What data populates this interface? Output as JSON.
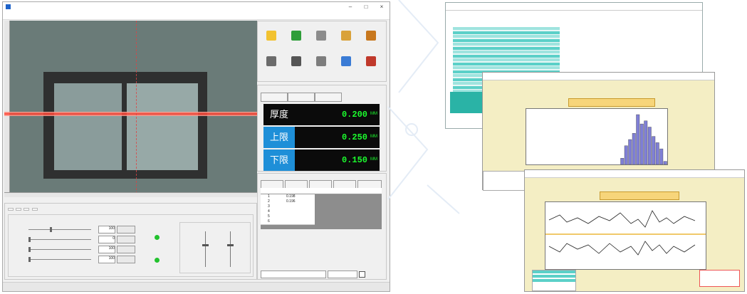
{
  "app": {
    "window_title": "",
    "menu": []
  },
  "camera": {},
  "tool_panel": {
    "title": "",
    "tools": [
      {
        "label": "",
        "icon": "lightbulb-icon",
        "color": "#f2c230"
      },
      {
        "label": "",
        "icon": "green-square-icon",
        "color": "#2f9e3a"
      },
      {
        "label": "",
        "icon": "stamp-icon",
        "color": "#8c8c8c"
      },
      {
        "label": "",
        "icon": "magnet-icon",
        "color": "#d9a23a"
      },
      {
        "label": "",
        "icon": "brush-icon",
        "color": "#c8781e"
      },
      {
        "label": "",
        "icon": "device-icon",
        "color": "#6b6b6b"
      },
      {
        "label": "",
        "icon": "helmet-icon",
        "color": "#555555"
      },
      {
        "label": "",
        "icon": "circle-icon",
        "color": "#7d7d7d"
      },
      {
        "label": "",
        "icon": "edit-icon",
        "color": "#3a7bd5"
      },
      {
        "label": "",
        "icon": "toolbox-icon",
        "color": "#c0392b"
      }
    ]
  },
  "readout": {
    "group_title": "",
    "tabs": [
      "",
      "",
      ""
    ],
    "rows": [
      {
        "label": "厚度",
        "value": "0.200",
        "unit": "MM",
        "label_bg": "#0b0b0b"
      },
      {
        "label": "上限",
        "value": "0.250",
        "unit": "MM",
        "label_bg": "#1e8fd8"
      },
      {
        "label": "下限",
        "value": "0.150",
        "unit": "MM",
        "label_bg": "#1e8fd8"
      }
    ]
  },
  "records": {
    "group_title": "",
    "buttons": [
      "",
      "",
      "",
      "",
      ""
    ],
    "headers": [
      "",
      "",
      "",
      "",
      ""
    ],
    "rows": [
      {
        "no": "1",
        "value": "0.198"
      },
      {
        "no": "2",
        "value": "0.196"
      },
      {
        "no": "3",
        "value": ""
      },
      {
        "no": "4",
        "value": ""
      },
      {
        "no": "5",
        "value": ""
      },
      {
        "no": "6",
        "value": ""
      }
    ]
  },
  "controls": {
    "tabs": [
      "",
      "",
      "",
      ""
    ],
    "sliders": [
      {
        "name": "",
        "value": "100",
        "level": 0.35
      },
      {
        "name": "",
        "value": "0",
        "level": 0.0
      },
      {
        "name": "",
        "value": "100",
        "level": 0.0
      },
      {
        "name": "",
        "value": "100",
        "level": 0.0
      }
    ]
  },
  "status_bar": {
    "left": "",
    "datetime": "",
    "right": ""
  },
  "reports": {
    "chart1_title": "",
    "chart2_title": "",
    "histogram_bins": [
      0,
      0,
      0,
      0,
      0,
      0,
      0,
      0,
      0,
      0,
      0,
      0,
      0,
      0,
      0,
      0,
      0,
      0,
      0,
      0,
      0,
      0,
      0,
      0,
      2,
      6,
      8,
      10,
      16,
      13,
      14,
      12,
      9,
      7,
      5,
      1
    ],
    "colors": {
      "panel_bg": "#f4eec4",
      "bar": "#7f7fd6",
      "title_bg": "#f7d57a",
      "table_cyan": "#5bd0c8"
    }
  }
}
